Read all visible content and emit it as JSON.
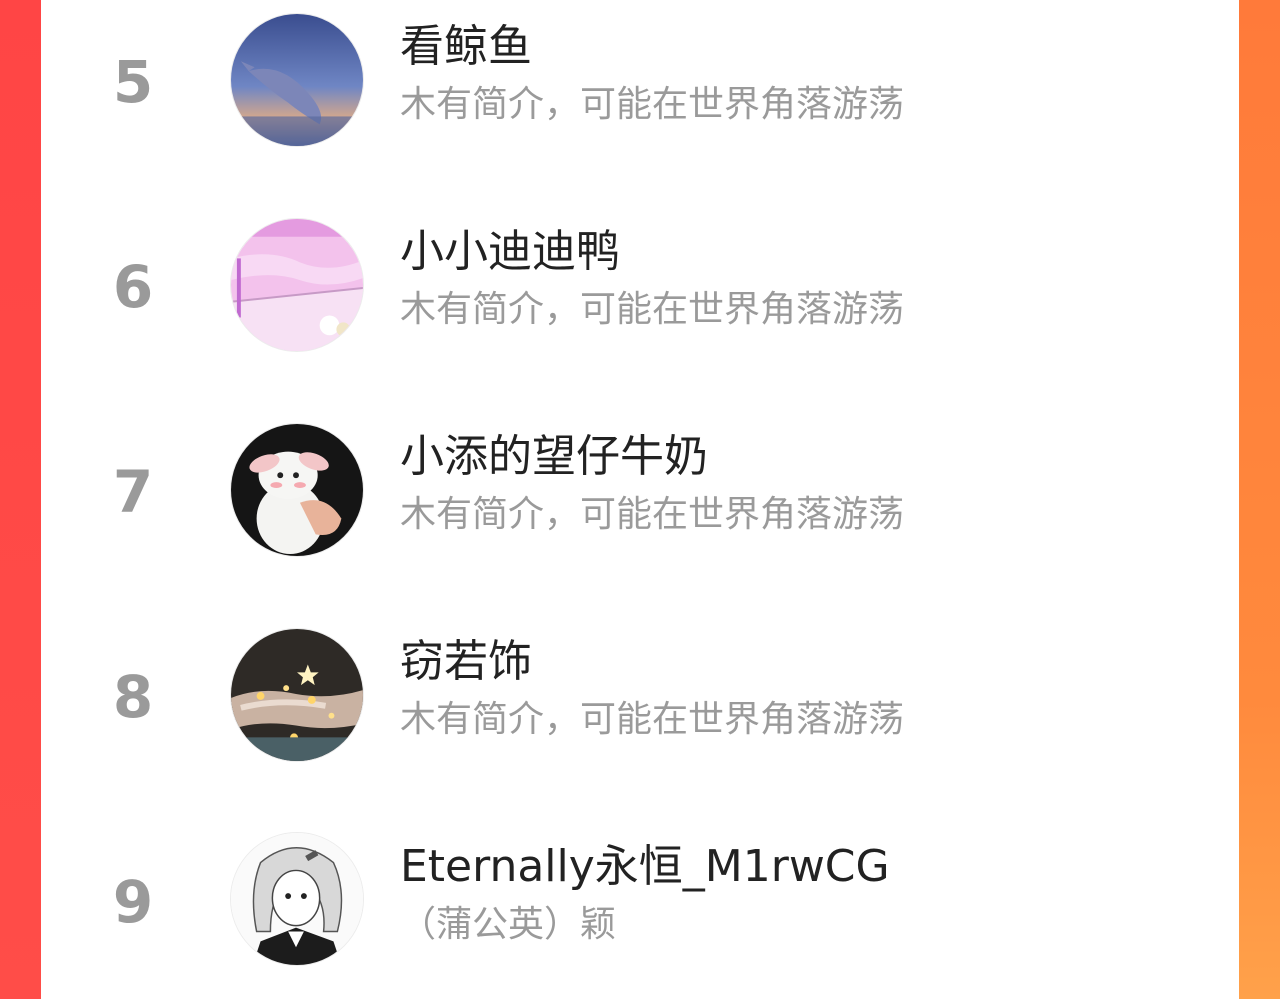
{
  "ranking": {
    "items": [
      {
        "rank": "5",
        "name": "看鲸鱼",
        "bio": "木有简介，可能在世界角落游荡",
        "avatar_icon": "whale-night-sky-avatar"
      },
      {
        "rank": "6",
        "name": "小小迪迪鸭",
        "bio": "木有简介，可能在世界角落游荡",
        "avatar_icon": "pink-room-avatar"
      },
      {
        "rank": "7",
        "name": "小添的望仔牛奶",
        "bio": "木有简介，可能在世界角落游荡",
        "avatar_icon": "white-bunny-avatar"
      },
      {
        "rank": "8",
        "name": "窃若饰",
        "bio": "木有简介，可能在世界角落游荡",
        "avatar_icon": "hands-fairy-lights-avatar"
      },
      {
        "rank": "9",
        "name": "Eternally永恒_M1rwCG",
        "bio": "（蒲公英）颖",
        "avatar_icon": "anime-girl-sketch-avatar"
      }
    ]
  },
  "colors": {
    "accent_left": "#ff4545",
    "accent_right": "#ff8a3d",
    "rank_text": "#9a9a9a",
    "name_text": "#222222",
    "bio_text": "#9a9a9a"
  }
}
